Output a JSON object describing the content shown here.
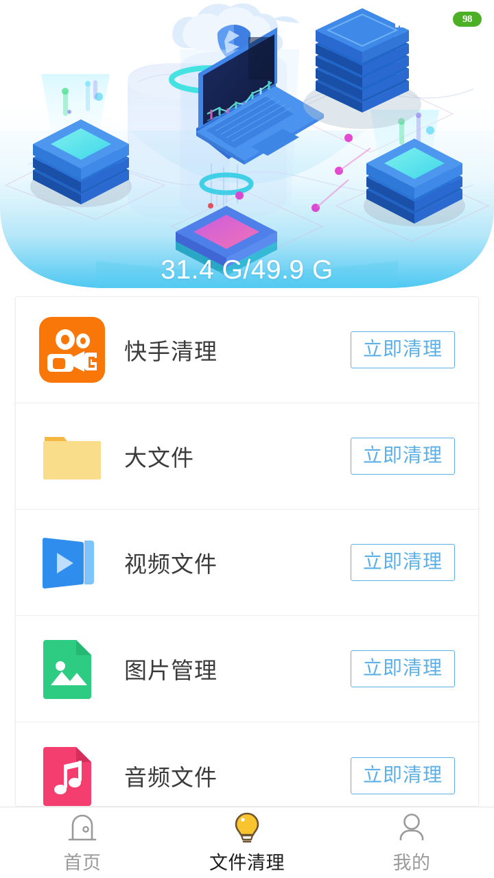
{
  "status_bar": {
    "signal_icon": "signal-bars-icon",
    "wifi_icon": "wifi-icon",
    "battery_level": "98"
  },
  "hero": {
    "illustration_name": "cloud-storage-isometric-illustration",
    "storage_used": "31.4 G",
    "storage_total": "49.9 G",
    "storage_text": "31.4 G/49.9 G",
    "gradient_start": "#ffffff",
    "gradient_end": "#4fc3f7"
  },
  "list": {
    "button_label": "立即清理",
    "accent_color": "#5cb0e6",
    "items": [
      {
        "id": "kuaishou",
        "label": "快手清理",
        "icon": "kuaishou-app-icon",
        "color": "#f97709",
        "action": "立即清理"
      },
      {
        "id": "bigfiles",
        "label": "大文件",
        "icon": "folder-icon",
        "color": "#f8d97a",
        "action": "立即清理"
      },
      {
        "id": "video",
        "label": "视频文件",
        "icon": "video-file-icon",
        "color": "#2f8ded",
        "action": "立即清理"
      },
      {
        "id": "image",
        "label": "图片管理",
        "icon": "image-file-icon",
        "color": "#2ecc82",
        "action": "立即清理"
      },
      {
        "id": "audio",
        "label": "音频文件",
        "icon": "audio-file-icon",
        "color": "#f43e6f",
        "action": "立即清理"
      }
    ]
  },
  "bottom_nav": {
    "active_index": 1,
    "items": [
      {
        "label": "首页",
        "icon": "home-door-icon",
        "active": false
      },
      {
        "label": "文件清理",
        "icon": "lightbulb-icon",
        "active": true
      },
      {
        "label": "我的",
        "icon": "person-icon",
        "active": false
      }
    ]
  }
}
